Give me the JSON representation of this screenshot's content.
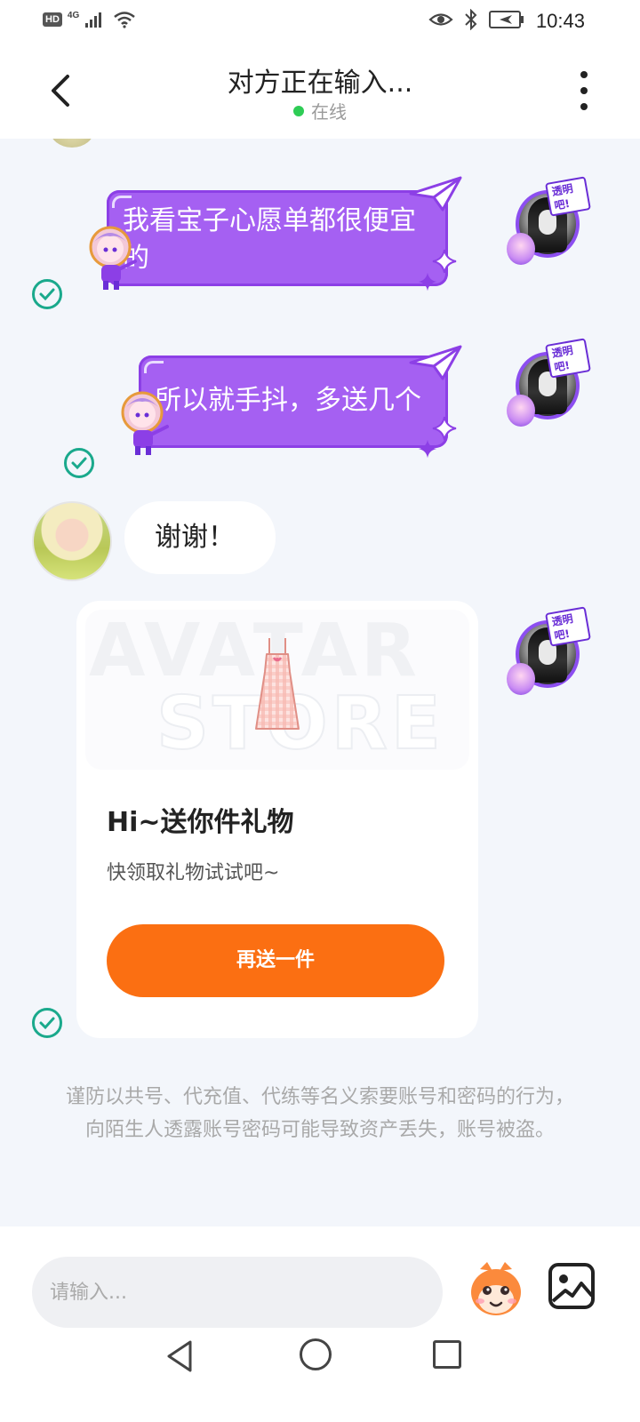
{
  "status_bar": {
    "hd_badge": "HD",
    "network": "4G",
    "time": "10:43"
  },
  "header": {
    "title": "对方正在输入...",
    "status": "在线",
    "status_color": "#2ecc55"
  },
  "messages": [
    {
      "from": "me",
      "text": "我看宝子心愿单都很便宜的",
      "read": true
    },
    {
      "from": "me",
      "text": "所以就手抖，多送几个",
      "read": true
    },
    {
      "from": "them",
      "text": "谢谢！"
    },
    {
      "from": "me",
      "type": "gift_card",
      "read": true
    }
  ],
  "gift_card": {
    "watermark_line1": "AVATAR",
    "watermark_line2": "STORE",
    "title": "Hi~送你件礼物",
    "subtitle": "快领取礼物试试吧~",
    "button_label": "再送一件",
    "button_color": "#fb6f12"
  },
  "avatar_tag": "透明吧!",
  "warning_text": "谨防以共号、代充值、代练等名义索要账号和密码的行为，向陌生人透露账号密码可能导致资产丢失，账号被盗。",
  "input": {
    "placeholder": "请输入..."
  },
  "colors": {
    "bubble_purple": "#a560f2",
    "read_check": "#1aa98c",
    "chat_bg": "#f3f6fb"
  }
}
